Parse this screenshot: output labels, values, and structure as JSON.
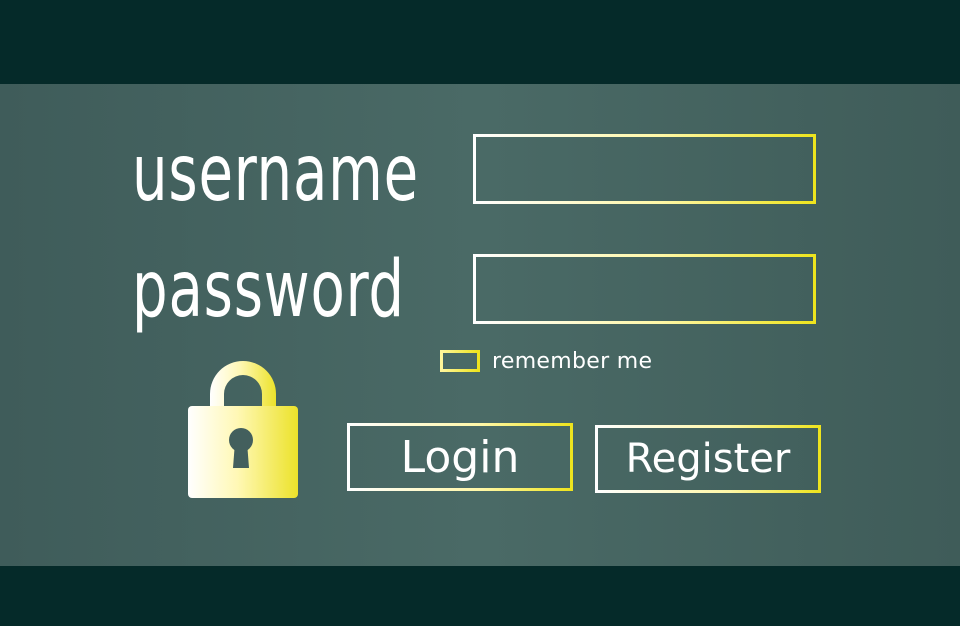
{
  "form": {
    "username_label": "username",
    "password_label": "password",
    "username_value": "",
    "password_value": "",
    "remember_label": "remember me",
    "remember_checked": false,
    "login_label": "Login",
    "register_label": "Register"
  },
  "icons": {
    "lock": "padlock-icon"
  },
  "colors": {
    "background_dark": "#052a29",
    "panel": "#46635f",
    "accent_yellow": "#eee41e",
    "text": "#ffffff"
  }
}
